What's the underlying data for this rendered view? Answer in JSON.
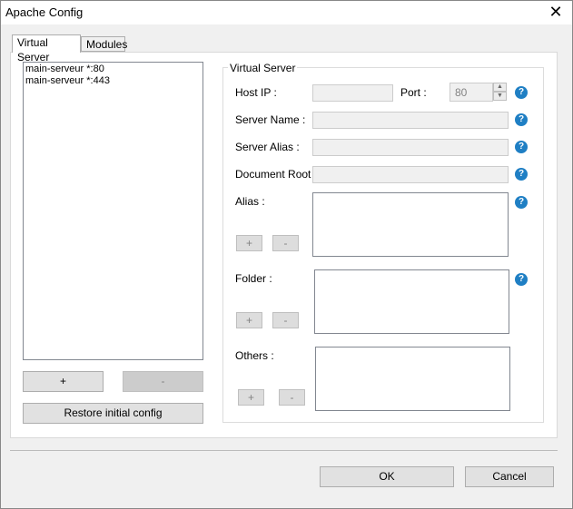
{
  "window": {
    "title": "Apache Config",
    "close_glyph": "✕"
  },
  "tabs": [
    {
      "label": "Virtual Server",
      "active": true
    },
    {
      "label": "Modules",
      "active": false
    }
  ],
  "server_list": {
    "items": [
      "main-serveur *:80",
      "main-serveur *:443"
    ],
    "add_label": "+",
    "remove_label": "-",
    "restore_label": "Restore initial config"
  },
  "virtual_server": {
    "legend": "Virtual Server",
    "host_ip_label": "Host IP :",
    "host_ip_value": "",
    "port_label": "Port :",
    "port_value": "80",
    "server_name_label": "Server Name :",
    "server_alias_label": "Server Alias :",
    "document_root_label": "Document Root :",
    "alias_label": "Alias :",
    "folder_label": "Folder :",
    "others_label": "Others :",
    "add_label": "+",
    "remove_label": "-",
    "help_glyph": "?"
  },
  "footer": {
    "ok_label": "OK",
    "cancel_label": "Cancel"
  },
  "colors": {
    "help_icon": "#1f7fc4",
    "panel_bg": "#ffffff",
    "window_bg": "#f0f0f0"
  }
}
